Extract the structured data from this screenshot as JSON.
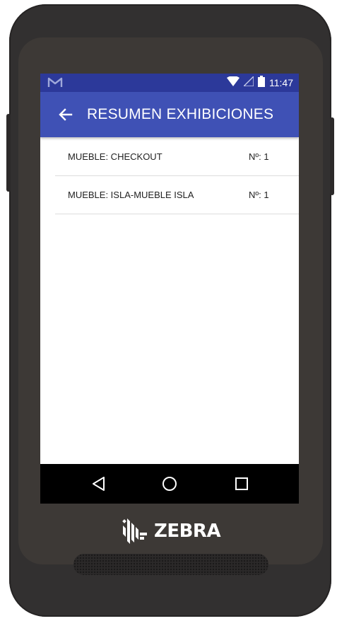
{
  "device": {
    "brand_name": "ZEBRA"
  },
  "status_bar": {
    "time": "11:47",
    "left_icon": "gmail-icon",
    "right_icons": [
      "wifi-icon",
      "signal-icon",
      "battery-icon"
    ]
  },
  "app_bar": {
    "title": "RESUMEN EXHIBICIONES",
    "back_icon": "arrow-left-icon"
  },
  "list": {
    "items": [
      {
        "label": "MUEBLE: CHECKOUT",
        "count": "Nº: 1"
      },
      {
        "label": "MUEBLE: ISLA-MUEBLE ISLA",
        "count": "Nº: 1"
      }
    ]
  },
  "nav_bar": {
    "icons": [
      "back-triangle-icon",
      "home-circle-icon",
      "recents-square-icon"
    ]
  },
  "colors": {
    "status_bar": "#2c399a",
    "app_bar": "#3f51b5",
    "device_body": "#323030",
    "nav_bar": "#000000"
  }
}
